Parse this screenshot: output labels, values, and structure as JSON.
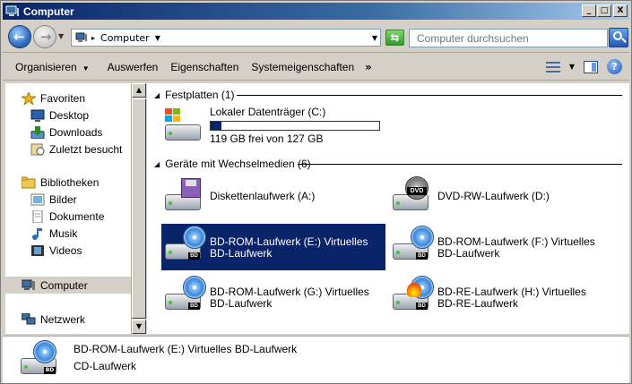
{
  "window": {
    "title": "Computer"
  },
  "title_buttons": {
    "minimize": "_",
    "maximize": "□",
    "close": "X"
  },
  "address": {
    "path_item": "Computer",
    "search_placeholder": "Computer durchsuchen"
  },
  "toolbar": {
    "items": [
      "Organisieren",
      "Auswerfen",
      "Eigenschaften",
      "Systemeigenschaften"
    ],
    "more": "»"
  },
  "nav": {
    "favorites_header": "Favoriten",
    "favorites": [
      "Desktop",
      "Downloads",
      "Zuletzt besucht"
    ],
    "libraries_header": "Bibliotheken",
    "libraries": [
      "Bilder",
      "Dokumente",
      "Musik",
      "Videos"
    ],
    "computer": "Computer",
    "network": "Netzwerk"
  },
  "groups": {
    "hard_disks": {
      "header": "Festplatten (1)",
      "drives": [
        {
          "name": "Lokaler Datenträger (C:)",
          "free_text": "119 GB frei von 127 GB",
          "used_fraction": 0.063
        }
      ]
    },
    "removable": {
      "header": "Geräte mit Wechselmedien (6)",
      "drives": [
        {
          "line1": "Diskettenlaufwerk (A:)",
          "line2": "",
          "icon": "floppy-drive-icon"
        },
        {
          "line1": "DVD-RW-Laufwerk (D:)",
          "line2": "",
          "icon": "dvd-drive-icon"
        },
        {
          "line1": "BD-ROM-Laufwerk (E:) Virtuelles",
          "line2": "BD-Laufwerk",
          "icon": "bd-drive-icon",
          "selected": true
        },
        {
          "line1": "BD-ROM-Laufwerk (F:) Virtuelles",
          "line2": "BD-Laufwerk",
          "icon": "bd-drive-icon"
        },
        {
          "line1": "BD-ROM-Laufwerk (G:) Virtuelles",
          "line2": "BD-Laufwerk",
          "icon": "bd-drive-icon"
        },
        {
          "line1": "BD-RE-Laufwerk (H:) Virtuelles",
          "line2": "BD-RE-Laufwerk",
          "icon": "bd-re-drive-icon"
        }
      ]
    }
  },
  "details": {
    "title": "BD-ROM-Laufwerk (E:) Virtuelles BD-Laufwerk",
    "subtitle": "CD-Laufwerk"
  },
  "colors": {
    "selection": "#0a246a",
    "titlebar_start": "#0a246a",
    "titlebar_end": "#a6caf0"
  }
}
